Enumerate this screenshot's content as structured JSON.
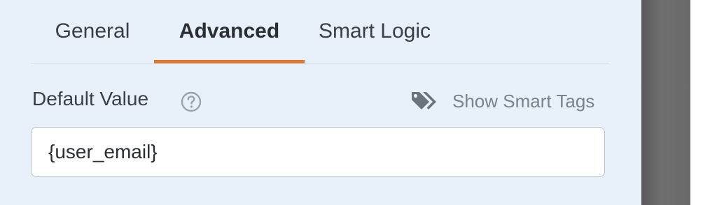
{
  "tabs": [
    {
      "label": "General",
      "active": false
    },
    {
      "label": "Advanced",
      "active": true
    },
    {
      "label": "Smart Logic",
      "active": false
    }
  ],
  "field": {
    "label": "Default Value",
    "help_icon": "question-circle-icon",
    "smart_tags_icon": "tags-icon",
    "smart_tags_label": "Show Smart Tags",
    "value": "{user_email}"
  },
  "colors": {
    "panel_bg": "#e8f1fa",
    "active_tab_underline": "#e27730",
    "input_border": "#b9c3cd",
    "muted_text": "#7a838c"
  }
}
